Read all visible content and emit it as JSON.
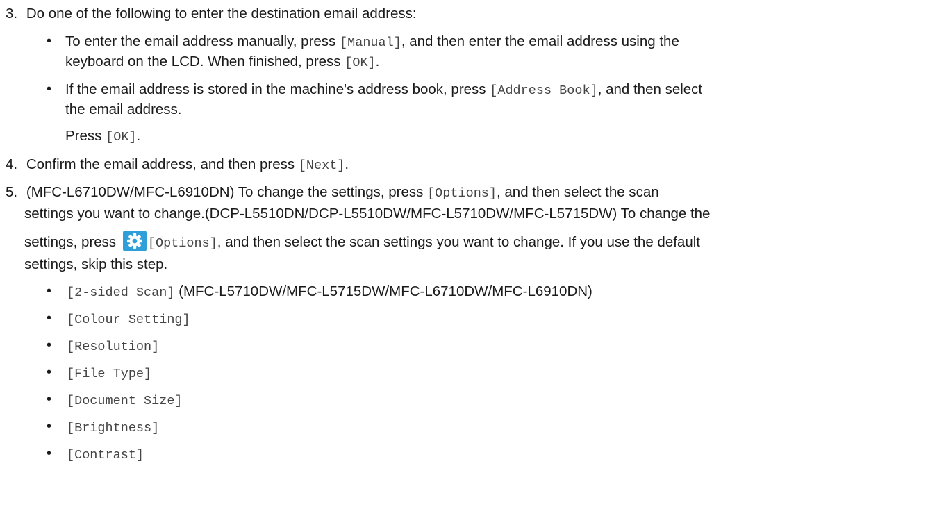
{
  "step3": {
    "number": "3.",
    "intro": "Do one of the following to enter the destination email address:",
    "bullet1": {
      "part1": "To enter the email address manually, press ",
      "code1": "[Manual]",
      "part2": ", and then enter the email address using the",
      "line2a": "keyboard on the LCD. When finished, press ",
      "code2": "[OK]",
      "line2b": "."
    },
    "bullet2": {
      "part1": "If the email address is stored in the machine's address book, press ",
      "code1": "[Address Book]",
      "part2": ", and then select",
      "line2": "the email address."
    },
    "press_ok": {
      "text": "Press ",
      "code": "[OK]",
      "end": "."
    }
  },
  "step4": {
    "number": "4.",
    "text": "Confirm the email address, and then press ",
    "code": "[Next]",
    "end": "."
  },
  "step5": {
    "number": "5.",
    "line1a": "(MFC-L6710DW/MFC-L6910DN) To change the settings, press ",
    "line1code": "[Options]",
    "line1b": ", and then select the scan",
    "line2": "settings you want to change.(DCP-L5510DN/DCP-L5510DW/MFC-L5710DW/MFC-L5715DW) To change the",
    "line3a": "settings, press ",
    "line3code": "[Options]",
    "line3b": ", and then select the scan settings you want to change. If you use the default",
    "line4": "settings, skip this step.",
    "gear_icon": "gear-icon",
    "gear_color": "#2e9fd8"
  },
  "options": [
    {
      "code": "[2-sided Scan]",
      "note": " (MFC-L5710DW/MFC-L5715DW/MFC-L6710DW/MFC-L6910DN)"
    },
    {
      "code": "[Colour Setting]",
      "note": ""
    },
    {
      "code": "[Resolution]",
      "note": ""
    },
    {
      "code": "[File Type]",
      "note": ""
    },
    {
      "code": "[Document Size]",
      "note": ""
    },
    {
      "code": "[Brightness]",
      "note": ""
    },
    {
      "code": "[Contrast]",
      "note": ""
    }
  ],
  "bullet_char": "•"
}
